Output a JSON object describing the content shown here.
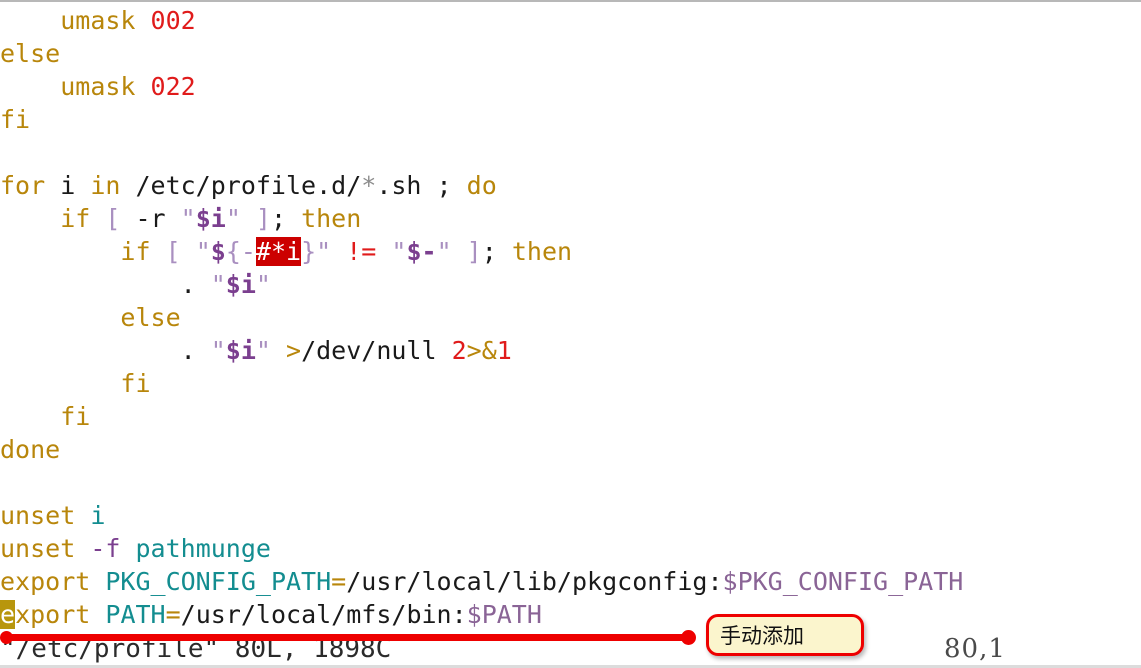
{
  "editor": {
    "app": "vim",
    "lines": [
      {
        "indent": 2,
        "tokens": [
          {
            "t": "umask ",
            "c": "kw"
          },
          {
            "t": "002",
            "c": "num"
          }
        ]
      },
      {
        "indent": 0,
        "tokens": [
          {
            "t": "else",
            "c": "kw"
          }
        ]
      },
      {
        "indent": 2,
        "tokens": [
          {
            "t": "umask ",
            "c": "kw"
          },
          {
            "t": "022",
            "c": "num"
          }
        ]
      },
      {
        "indent": 0,
        "tokens": [
          {
            "t": "fi",
            "c": "kw"
          }
        ]
      },
      {
        "indent": 0,
        "tokens": []
      },
      {
        "indent": 0,
        "tokens": [
          {
            "t": "for",
            "c": "kw"
          },
          {
            "t": " i ",
            "c": "pth"
          },
          {
            "t": "in",
            "c": "kw"
          },
          {
            "t": " /etc/profile.d/",
            "c": "pth"
          },
          {
            "t": "*",
            "c": "glob"
          },
          {
            "t": ".sh ",
            "c": "pth"
          },
          {
            "t": ";",
            "c": "pth"
          },
          {
            "t": " do",
            "c": "kw"
          }
        ]
      },
      {
        "indent": 2,
        "tokens": [
          {
            "t": "if",
            "c": "kw"
          },
          {
            "t": " [ ",
            "c": "str"
          },
          {
            "t": "-r",
            "c": "pth"
          },
          {
            "t": " \"",
            "c": "str"
          },
          {
            "t": "$i",
            "c": "var"
          },
          {
            "t": "\" ]",
            "c": "str"
          },
          {
            "t": ";",
            "c": "pth"
          },
          {
            "t": " then",
            "c": "kw"
          }
        ]
      },
      {
        "indent": 4,
        "tokens": [
          {
            "t": "if",
            "c": "kw"
          },
          {
            "t": " [ ",
            "c": "str"
          },
          {
            "t": "\"",
            "c": "str"
          },
          {
            "t": "$",
            "c": "var"
          },
          {
            "t": "{-",
            "c": "str"
          },
          {
            "t": "#*i",
            "c": "hl"
          },
          {
            "t": "}",
            "c": "str"
          },
          {
            "t": "\" ",
            "c": "str"
          },
          {
            "t": "!=",
            "c": "num"
          },
          {
            "t": " \"",
            "c": "str"
          },
          {
            "t": "$-",
            "c": "var"
          },
          {
            "t": "\" ]",
            "c": "str"
          },
          {
            "t": ";",
            "c": "pth"
          },
          {
            "t": " then",
            "c": "kw"
          }
        ]
      },
      {
        "indent": 6,
        "tokens": [
          {
            "t": ". ",
            "c": "pth"
          },
          {
            "t": "\"",
            "c": "str"
          },
          {
            "t": "$i",
            "c": "var"
          },
          {
            "t": "\"",
            "c": "str"
          }
        ]
      },
      {
        "indent": 4,
        "tokens": [
          {
            "t": "else",
            "c": "kw"
          }
        ]
      },
      {
        "indent": 6,
        "tokens": [
          {
            "t": ". ",
            "c": "pth"
          },
          {
            "t": "\"",
            "c": "str"
          },
          {
            "t": "$i",
            "c": "var"
          },
          {
            "t": "\" ",
            "c": "str"
          },
          {
            "t": ">",
            "c": "op"
          },
          {
            "t": "/dev/null ",
            "c": "pth"
          },
          {
            "t": "2",
            "c": "num"
          },
          {
            "t": ">&",
            "c": "op"
          },
          {
            "t": "1",
            "c": "num"
          }
        ]
      },
      {
        "indent": 4,
        "tokens": [
          {
            "t": "fi",
            "c": "kw"
          }
        ]
      },
      {
        "indent": 2,
        "tokens": [
          {
            "t": "fi",
            "c": "kw"
          }
        ]
      },
      {
        "indent": 0,
        "tokens": [
          {
            "t": "done",
            "c": "kw"
          }
        ]
      },
      {
        "indent": 0,
        "tokens": []
      },
      {
        "indent": 0,
        "tokens": [
          {
            "t": "unset",
            "c": "kw"
          },
          {
            "t": " ",
            "c": "pth"
          },
          {
            "t": "i",
            "c": "ident"
          }
        ]
      },
      {
        "indent": 0,
        "tokens": [
          {
            "t": "unset",
            "c": "kw"
          },
          {
            "t": " ",
            "c": "pth"
          },
          {
            "t": "-f",
            "c": "opt"
          },
          {
            "t": " ",
            "c": "pth"
          },
          {
            "t": "pathmunge",
            "c": "ident"
          }
        ]
      },
      {
        "indent": 0,
        "tokens": [
          {
            "t": "export",
            "c": "kw"
          },
          {
            "t": " ",
            "c": "pth"
          },
          {
            "t": "PKG_CONFIG_PATH",
            "c": "ident"
          },
          {
            "t": "=",
            "c": "op"
          },
          {
            "t": "/usr/local/lib/pkgconfig:",
            "c": "pth"
          },
          {
            "t": "$PKG_CONFIG_PATH",
            "c": "var2"
          }
        ]
      },
      {
        "indent": 0,
        "tokens": [
          {
            "t": "e",
            "c": "cursor"
          },
          {
            "t": "xport",
            "c": "kw"
          },
          {
            "t": " ",
            "c": "pth"
          },
          {
            "t": "PATH",
            "c": "ident"
          },
          {
            "t": "=",
            "c": "op"
          },
          {
            "t": "/usr/local/mfs/bin:",
            "c": "pth"
          },
          {
            "t": "$PATH",
            "c": "var2"
          }
        ]
      }
    ]
  },
  "statusline": {
    "file_info": "\"/etc/profile\" 80L, 1898C",
    "cursor_position": "80,1"
  },
  "annotation": {
    "callout_text": "手动添加",
    "line_color": "#ee0000",
    "box_fill": "#fbf5cd",
    "box_border": "#ee0000"
  },
  "colors": {
    "background": "#ffffff",
    "keyword": "#b8860b",
    "number": "#e01b1b",
    "string": "#a98fc0",
    "variable": "#7b3f8f",
    "identifier": "#138d90",
    "plain": "#1a1a1a",
    "match_highlight_bg": "#cc0000",
    "cursor_bg": "#b8960c"
  }
}
